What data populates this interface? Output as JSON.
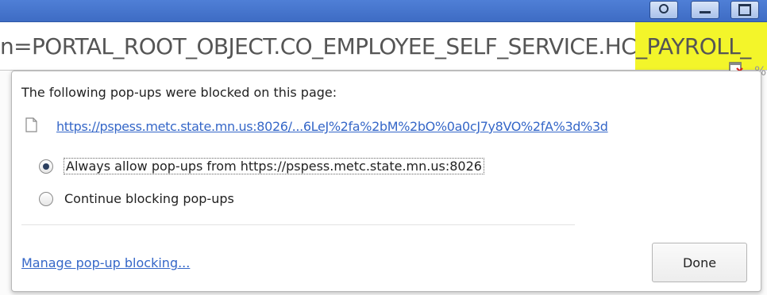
{
  "window": {
    "buttons": {
      "user": "user-icon",
      "minimize": "minimize-icon",
      "maximize": "maximize-icon"
    }
  },
  "address_bar": {
    "url_visible": "n=PORTAL_ROOT_OBJECT.CO_EMPLOYEE_SELF_SERVICE.HC_PAYROLL_",
    "trailing": "%",
    "blocked_icon": "popup-blocked-icon"
  },
  "popup": {
    "heading": "The following pop-ups were blocked on this page:",
    "blocked_url": "https://pspess.metc.state.mn.us:8026/...6LeJ%2fa%2bM%2bO%0a0cJ7y8VO%2fA%3d%3d",
    "options": [
      {
        "label": "Always allow pop-ups from https://pspess.metc.state.mn.us:8026",
        "selected": true
      },
      {
        "label": "Continue blocking pop-ups",
        "selected": false
      }
    ],
    "manage_link": "Manage pop-up blocking...",
    "done_label": "Done"
  },
  "colors": {
    "highlight": "#f3f52a",
    "link": "#3567c8",
    "titlebar": "#3e6cc4"
  }
}
